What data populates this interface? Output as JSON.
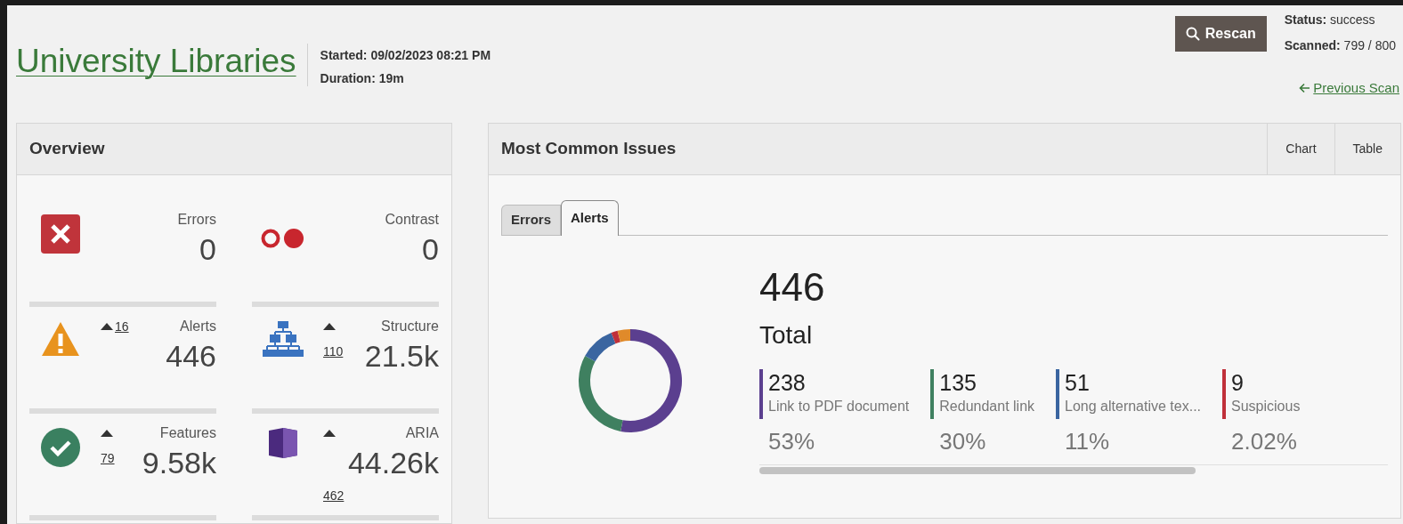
{
  "header": {
    "title": "University Libraries",
    "started_label": "Started:",
    "started": "09/02/2023 08:21 PM",
    "duration_label": "Duration:",
    "duration": "19m",
    "rescan_button": "Rescan",
    "status_label": "Status:",
    "status": "success",
    "scanned_label": "Scanned:",
    "scanned": "799 / 800",
    "previous_link": "Previous Scan"
  },
  "overview": {
    "title": "Overview",
    "tiles": [
      {
        "kind": "error",
        "label": "Errors",
        "value": "0"
      },
      {
        "kind": "contrast",
        "label": "Contrast",
        "value": "0"
      },
      {
        "kind": "alert",
        "label": "Alerts",
        "value": "446",
        "delta": {
          "kind": "inline",
          "value": "16"
        }
      },
      {
        "kind": "structure",
        "label": "Structure",
        "value": "21.5k",
        "delta": {
          "kind": "beside",
          "value": "110"
        }
      },
      {
        "kind": "feature",
        "label": "Features",
        "value": "9.58k",
        "delta": {
          "kind": "beside",
          "value": "79"
        }
      },
      {
        "kind": "aria",
        "label": "ARIA",
        "value": "44.26k",
        "delta": {
          "kind": "below",
          "value": "462"
        }
      }
    ]
  },
  "issues": {
    "title": "Most Common Issues",
    "view_buttons": [
      "Chart",
      "Table"
    ],
    "tabs": [
      {
        "label": "Errors",
        "selected": false
      },
      {
        "label": "Alerts",
        "selected": true
      }
    ],
    "total": "446",
    "total_label": "Total",
    "chart_data": {
      "type": "donut",
      "values": [
        53,
        30,
        11,
        2.02,
        3.98
      ],
      "colors": [
        "#5b3f8f",
        "#3f8060",
        "#3a65a0",
        "#c0303a",
        "#e08a2a"
      ]
    },
    "items": [
      {
        "count": "238",
        "label": "Link to PDF document",
        "percent": "53%",
        "color": "#5b3f8f"
      },
      {
        "count": "135",
        "label": "Redundant link",
        "percent": "30%",
        "color": "#3f8060"
      },
      {
        "count": "51",
        "label": "Long alternative tex...",
        "percent": "11%",
        "color": "#3a65a0"
      },
      {
        "count": "9",
        "label": "Suspicious",
        "percent": "2.02%",
        "color": "#c0303a"
      }
    ]
  }
}
